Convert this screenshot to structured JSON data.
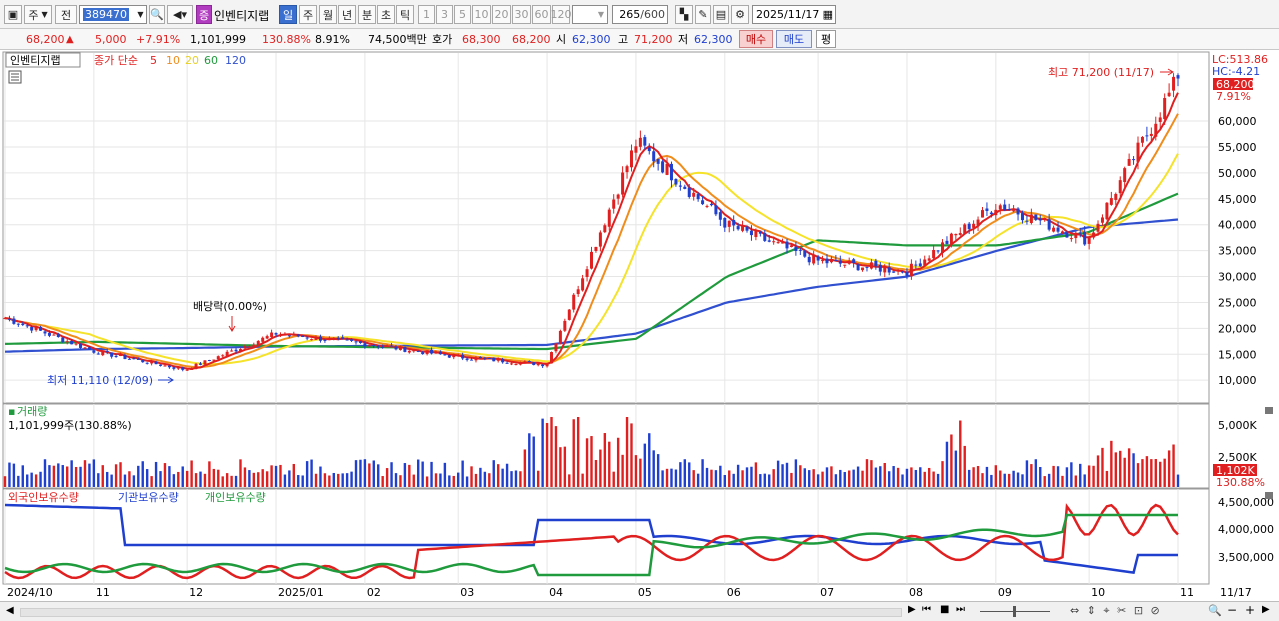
{
  "toolbar": {
    "market": "주",
    "mode": "전",
    "code": "389470",
    "stock_badge": "증",
    "stock_name": "인벤티지랩",
    "periods": [
      "일",
      "주",
      "월",
      "년",
      "분",
      "초",
      "틱"
    ],
    "intervals": [
      "1",
      "3",
      "5",
      "10",
      "20",
      "30",
      "60",
      "120"
    ],
    "count": "265",
    "count_total": "/600",
    "date": "2025/11/17"
  },
  "quote": {
    "price": "68,200",
    "change": "5,000",
    "change_pct": "+7.91%",
    "volume": "1,101,999",
    "volume_pct": "130.88%",
    "turnover_pct": "8.91%",
    "amount": "74,500백만",
    "hoga_label": "호가",
    "hoga_ask": "68,300",
    "hoga_bid": "68,200",
    "open_label": "시",
    "open": "62,300",
    "high_label": "고",
    "high": "71,200",
    "low_label": "저",
    "low": "62,300",
    "buy_label": "매수",
    "sell_label": "매도",
    "avg_label": "평"
  },
  "colors": {
    "up": "#e02020",
    "down": "#1f3fcf",
    "ma5": "#e02020",
    "ma10": "#f08c1a",
    "ma20": "#f5e22a",
    "ma60": "#1f9a3c",
    "ma120": "#3050d0"
  },
  "price_panel": {
    "legend_name": "인벤티지랩",
    "legend_ma_title": "종가 단순",
    "ma_periods": [
      "5",
      "10",
      "20",
      "60",
      "120"
    ],
    "y_ticks": [
      "60,000",
      "55,000",
      "50,000",
      "45,000",
      "40,000",
      "35,000",
      "30,000",
      "25,000",
      "20,000",
      "15,000",
      "10,000"
    ],
    "lc_label": "LC:513.86",
    "hc_label": "HC:-4.21",
    "last_price_tag": "68,200",
    "last_pct_tag": "7.91%",
    "max_annot": "최고 71,200 (11/17)",
    "min_annot": "최저 11,110 (12/09)",
    "dividend_annot": "배당락(0.00%)"
  },
  "volume_panel": {
    "title": "거래량",
    "value_text": "1,101,999주(130.88%)",
    "y_ticks": [
      "5,000K",
      "2,500K"
    ],
    "last_tag": "1,102K",
    "last_pct_tag": "130.88%"
  },
  "holding_panel": {
    "legend": [
      "외국인보유수량",
      "기관보유수량",
      "개인보유수량"
    ],
    "y_ticks": [
      "4,500,000",
      "4,000,000",
      "3,500,000"
    ]
  },
  "x_axis": {
    "labels": [
      "2024/10",
      "11",
      "12",
      "2025/01",
      "02",
      "03",
      "04",
      "05",
      "06",
      "07",
      "08",
      "09",
      "10",
      "11"
    ],
    "last_date": "11/17"
  },
  "chart_data": {
    "type": "candlestick",
    "title": "인벤티지랩",
    "y_range": [
      8000,
      72000
    ],
    "months": [
      "2024/10",
      "11",
      "12",
      "2025/01",
      "02",
      "03",
      "04",
      "05",
      "06",
      "07",
      "08",
      "09",
      "10",
      "11"
    ],
    "monthly_close_approx": [
      22000,
      15500,
      12000,
      19000,
      17000,
      14500,
      13000,
      56000,
      40000,
      33000,
      31000,
      44000,
      37000,
      68200
    ],
    "ma120_approx": [
      15500,
      16000,
      16200,
      16500,
      16600,
      16700,
      16800,
      19000,
      25000,
      28000,
      30000,
      35000,
      39500,
      41000
    ],
    "ma60_approx": [
      17000,
      17400,
      17000,
      16600,
      16400,
      16200,
      16000,
      18000,
      30000,
      37000,
      36000,
      36000,
      38500,
      46000
    ],
    "max": {
      "value": 71200,
      "date": "11/17"
    },
    "min": {
      "value": 11110,
      "date": "12/09"
    },
    "last": 68200,
    "volume_last": 1101999,
    "holding_series": [
      "외국인보유수량",
      "기관보유수량",
      "개인보유수량"
    ]
  }
}
